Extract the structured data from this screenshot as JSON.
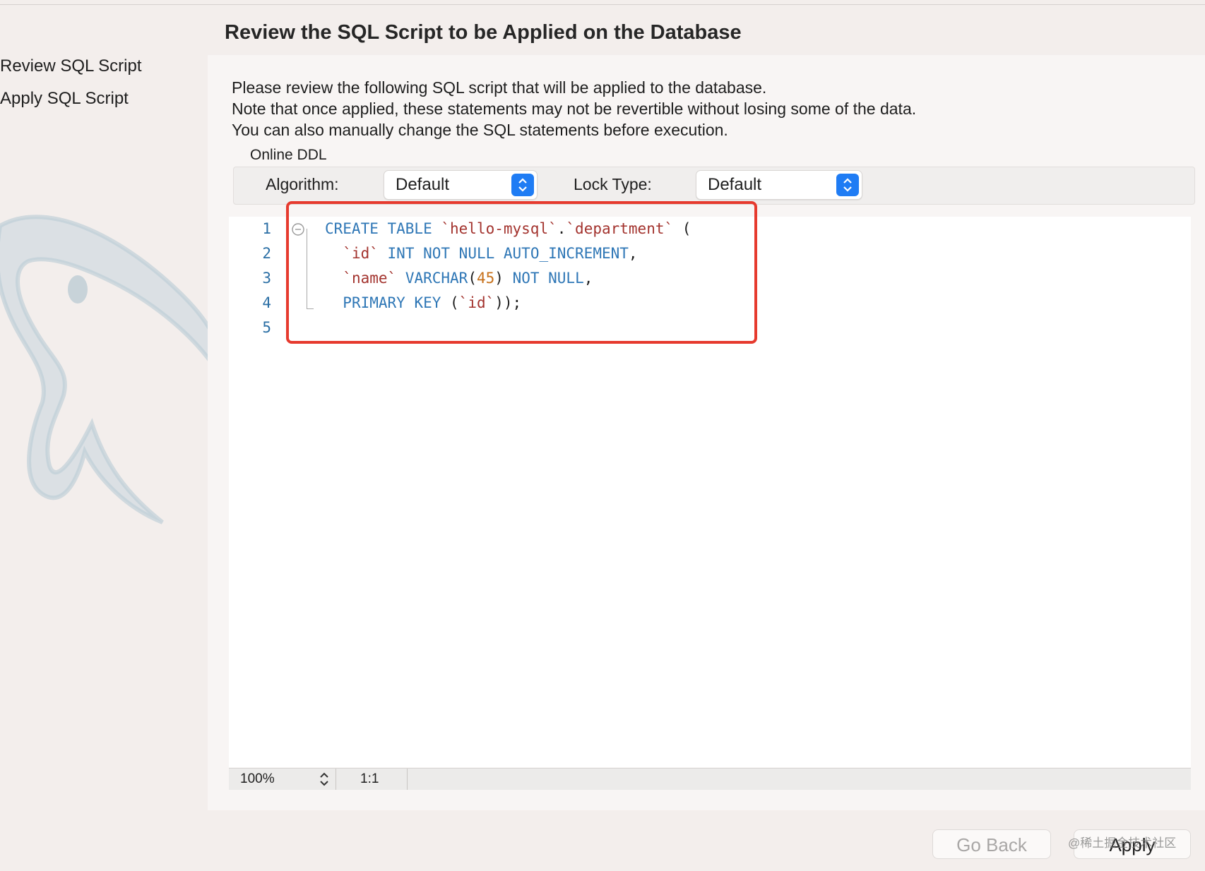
{
  "page_title": "Review the SQL Script to be Applied on the Database",
  "steps": [
    {
      "label": "Review SQL Script"
    },
    {
      "label": "Apply SQL Script"
    }
  ],
  "description": [
    "Please review the following SQL script that will be applied to the database.",
    "Note that once applied, these statements may not be revertible without losing some of the data.",
    "You can also manually change the SQL statements before execution."
  ],
  "online_ddl": {
    "title": "Online DDL",
    "algorithm_label": "Algorithm:",
    "algorithm_value": "Default",
    "lock_type_label": "Lock Type:",
    "lock_type_value": "Default"
  },
  "editor": {
    "line_numbers": [
      "1",
      "2",
      "3",
      "4",
      "5"
    ],
    "lines": [
      [
        {
          "t": "CREATE TABLE",
          "c": "kw"
        },
        {
          "t": " ",
          "c": "pun"
        },
        {
          "t": "`hello-mysql`",
          "c": "id"
        },
        {
          "t": ".",
          "c": "pun"
        },
        {
          "t": "`department`",
          "c": "id"
        },
        {
          "t": " (",
          "c": "pun"
        }
      ],
      [
        {
          "t": "  ",
          "c": "pun"
        },
        {
          "t": "`id`",
          "c": "id"
        },
        {
          "t": " ",
          "c": "pun"
        },
        {
          "t": "INT NOT NULL AUTO_INCREMENT",
          "c": "kw"
        },
        {
          "t": ",",
          "c": "pun"
        }
      ],
      [
        {
          "t": "  ",
          "c": "pun"
        },
        {
          "t": "`name`",
          "c": "id"
        },
        {
          "t": " ",
          "c": "pun"
        },
        {
          "t": "VARCHAR",
          "c": "kw"
        },
        {
          "t": "(",
          "c": "pun"
        },
        {
          "t": "45",
          "c": "num"
        },
        {
          "t": ") ",
          "c": "pun"
        },
        {
          "t": "NOT NULL",
          "c": "kw"
        },
        {
          "t": ",",
          "c": "pun"
        }
      ],
      [
        {
          "t": "  ",
          "c": "pun"
        },
        {
          "t": "PRIMARY KEY",
          "c": "kw"
        },
        {
          "t": " (",
          "c": "pun"
        },
        {
          "t": "`id`",
          "c": "id"
        },
        {
          "t": "));",
          "c": "pun"
        }
      ],
      []
    ]
  },
  "status_bar": {
    "zoom": "100%",
    "cursor_position": "1:1"
  },
  "buttons": {
    "go_back": "Go Back",
    "apply": "Apply"
  },
  "watermark": "@稀土掘金技术社区",
  "colors": {
    "keyword": "#2f77b6",
    "identifier": "#a3332e",
    "number": "#c7711b",
    "highlight_border": "#e63a2e",
    "select_accent": "#1f7cf4"
  }
}
